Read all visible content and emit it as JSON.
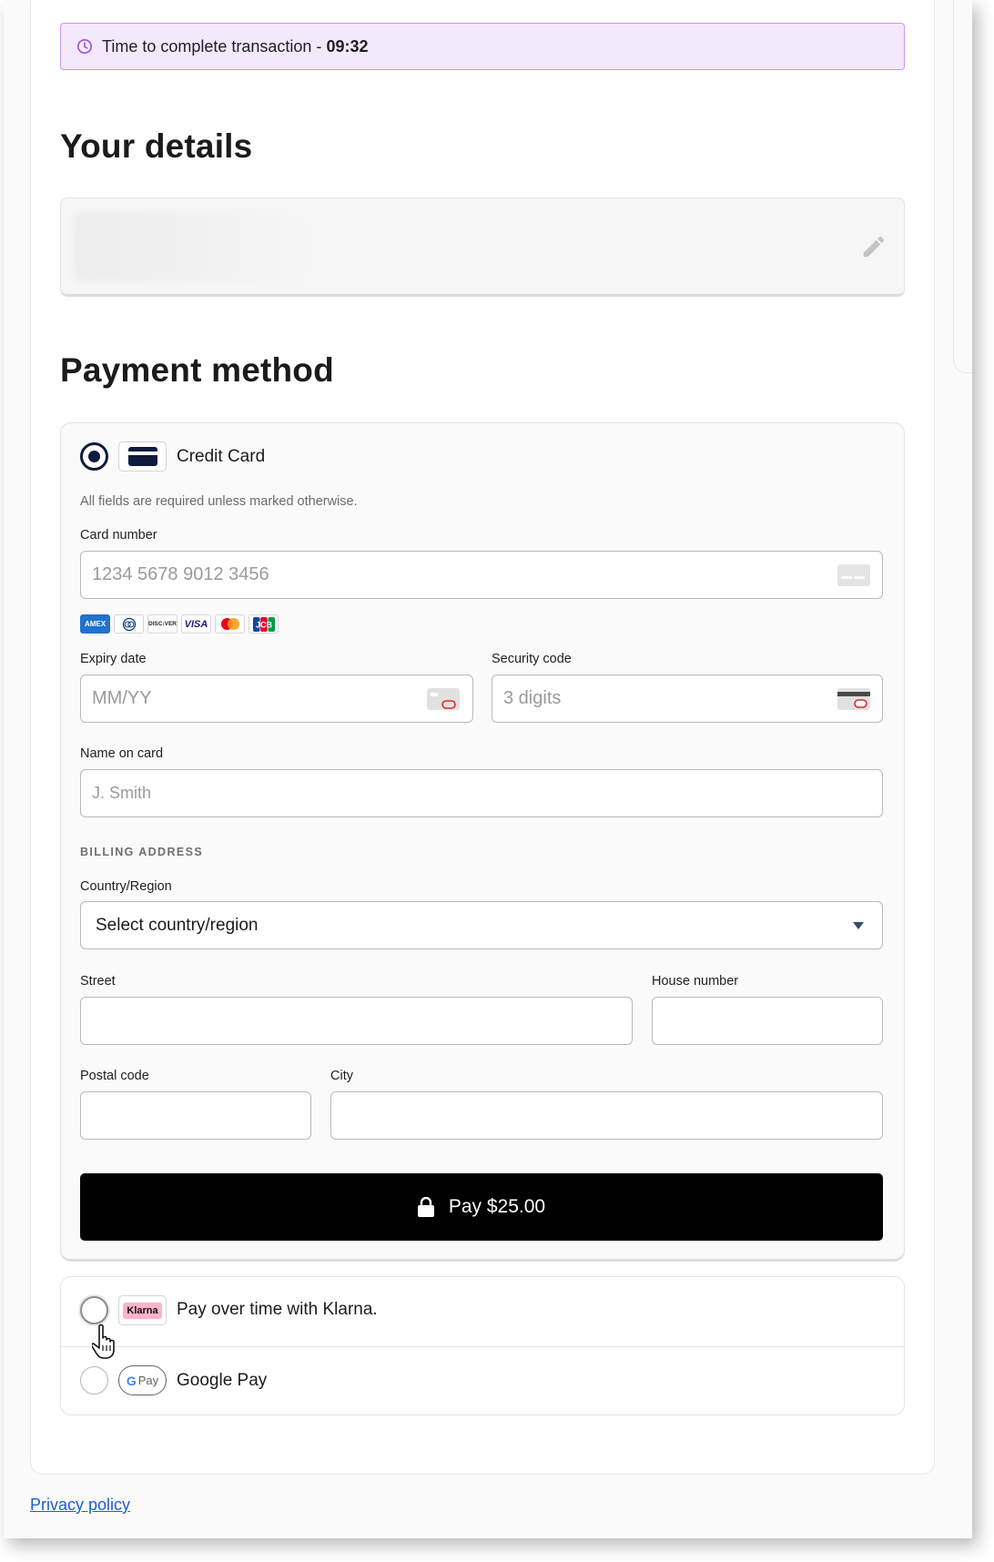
{
  "timer": {
    "label": "Time to complete transaction - ",
    "time": "09:32",
    "icon": "clock-icon",
    "accent": "#9b4fd6"
  },
  "details": {
    "title": "Your details",
    "edit_icon": "pencil-icon"
  },
  "payment": {
    "title": "Payment method",
    "credit_card": {
      "label": "Credit Card",
      "icon": "credit-card-icon",
      "note": "All fields are required unless marked otherwise.",
      "card_number_label": "Card number",
      "card_number_placeholder": "1234 5678 9012 3456",
      "brands": [
        "AMEX",
        "Diners",
        "DISCOVER",
        "VISA",
        "Mastercard",
        "JCB"
      ],
      "expiry_label": "Expiry date",
      "expiry_placeholder": "MM/YY",
      "security_label": "Security code",
      "security_placeholder": "3 digits",
      "name_label": "Name on card",
      "name_placeholder": "J. Smith",
      "billing_label": "BILLING ADDRESS",
      "country_label": "Country/Region",
      "country_value": "Select country/region",
      "street_label": "Street",
      "house_label": "House number",
      "postal_label": "Postal code",
      "city_label": "City",
      "pay_label": "Pay $25.00"
    },
    "klarna": {
      "logo_text": "Klarna",
      "label": "Pay over time with Klarna.",
      "logo_color": "#ffb3c7"
    },
    "google_pay": {
      "logo_text": "Pay",
      "label": "Google Pay"
    }
  },
  "footer": {
    "privacy_link": "Privacy policy"
  }
}
